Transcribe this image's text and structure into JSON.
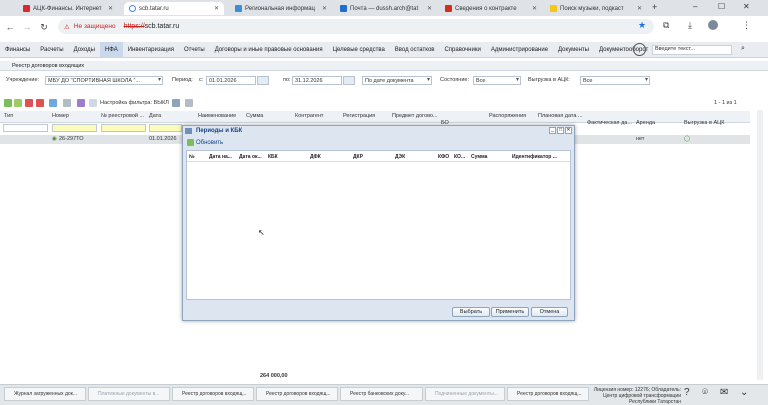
{
  "browser": {
    "tabs": [
      {
        "label": "АЦК-Финансы. Интернет",
        "active": false
      },
      {
        "label": "scb.tatar.ru",
        "active": true
      },
      {
        "label": "Региональная информац",
        "active": false
      },
      {
        "label": "Почта — dussh.arch@tat",
        "active": false
      },
      {
        "label": "Сведения о контракте",
        "active": false
      },
      {
        "label": "Поиск музыки, подкаст",
        "active": false
      }
    ],
    "new_tab": "+",
    "security_label": "Не защищено",
    "url_scheme": "https://",
    "url_host": "scb.tatar.ru"
  },
  "menu": {
    "items": [
      "Финансы",
      "Расчеты",
      "Доходы",
      "НФА",
      "Инвентаризация",
      "Отчеты",
      "Договоры и иные правовые основания",
      "Целевые средства",
      "Ввод остатков",
      "Справочники",
      "Администрирование",
      "Документы",
      "Документооборот"
    ],
    "selected": "НФА",
    "search_placeholder": "Введите текст..."
  },
  "register": {
    "title": "Реестр договоров входящих",
    "filters": {
      "institution_label": "Учреждение:",
      "institution_value": "МБУ ДО \"СПОРТИВНАЯ ШКОЛА \"...",
      "period_label": "Период:",
      "from_label": "с:",
      "from_value": "01.01.2026",
      "to_label": "по:",
      "to_value": "31.12.2026",
      "date_mode": "По дате документа",
      "state_label": "Состояние:",
      "state_value": "Все",
      "export_label": "Выгрузка в АЦК:",
      "export_value": "Все"
    },
    "filter_settings": "Настройка фильтра: ВЫКЛ",
    "pager": "1 - 1 из 1",
    "columns": [
      "Тип",
      "Номер",
      "№ реестровой ...",
      "Дата",
      "Наименование",
      "Сумма",
      "Контрагент",
      "Регистрация",
      "Предмет догово...",
      "",
      "Распоряжения",
      "Плановая дата ...",
      "Фактическая да...",
      "Аренда",
      "Выгрузка в АЦК"
    ],
    "sub_columns": [
      "БО"
    ],
    "row": {
      "number": "26-297ТО",
      "date": "01.01.2026",
      "rent": "нет"
    },
    "total": "264 000,00"
  },
  "modal": {
    "title": "Периоды и КБК",
    "refresh_label": "Обновить",
    "columns": [
      "№",
      "Дата на...",
      "Дата ок...",
      "КБК",
      "ДФК",
      "ДКР",
      "ДЭК",
      "КФО",
      "КО...",
      "Сумма",
      "Идентификатор ..."
    ],
    "buttons": {
      "select": "Выбрать",
      "apply": "Применить",
      "cancel": "Отмена"
    }
  },
  "taskbar": {
    "items": [
      {
        "label": "Журнал загруженных док...",
        "dim": false
      },
      {
        "label": "Платежные документы в...",
        "dim": true
      },
      {
        "label": "Реестр договоров входящ...",
        "dim": false
      },
      {
        "label": "Реестр договоров входящ...",
        "dim": false
      },
      {
        "label": "Реестр банковских доку...",
        "dim": false
      },
      {
        "label": "Подчиненные документы...",
        "dim": true
      },
      {
        "label": "Реестр договоров входящ...",
        "dim": false
      }
    ],
    "license_line1": "Лицензия номер: 12276; Обладатель:",
    "license_line2": "Центр цифровой трансформации Республики Татарстан"
  },
  "colors": {
    "accent": "#15428b",
    "selected_row": "#e1e4e7",
    "filter_highlight": "#fdfbb9",
    "insecure": "#c5221f"
  }
}
